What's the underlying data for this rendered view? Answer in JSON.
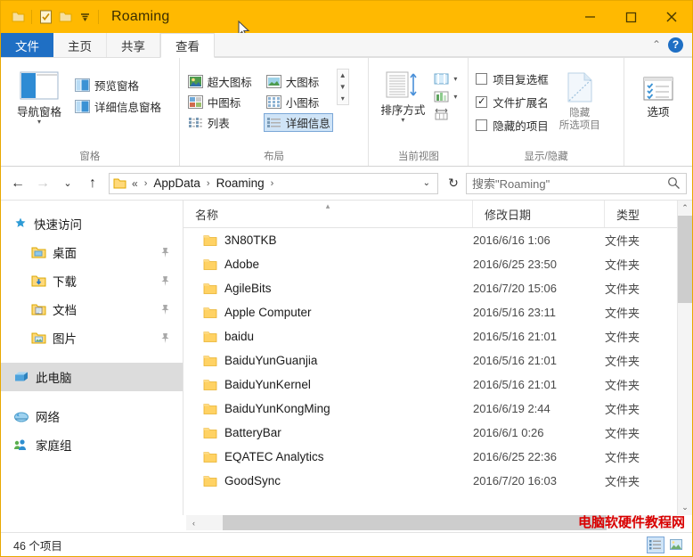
{
  "window": {
    "title": "Roaming",
    "quick_access": [
      {
        "name": "folder-icon",
        "label": ""
      },
      {
        "name": "properties-icon",
        "label": ""
      },
      {
        "name": "new-folder-icon",
        "label": ""
      },
      {
        "name": "chevron-down-icon",
        "label": "▾"
      }
    ],
    "controls": {
      "minimize": "—",
      "maximize": "□",
      "close": "✕"
    }
  },
  "tabs": [
    {
      "id": "file",
      "label": "文件"
    },
    {
      "id": "home",
      "label": "主页"
    },
    {
      "id": "share",
      "label": "共享"
    },
    {
      "id": "view",
      "label": "查看"
    }
  ],
  "tabstrip_right": {
    "collapse": "⌃",
    "help": "?"
  },
  "ribbon": {
    "groups": [
      {
        "id": "panes",
        "label": "窗格",
        "big": {
          "label": "导航窗格",
          "caret": "▾",
          "icon": "navigation-pane-icon"
        },
        "items": [
          {
            "label": "预览窗格",
            "icon": "preview-pane-icon"
          },
          {
            "label": "详细信息窗格",
            "icon": "details-pane-icon"
          }
        ]
      },
      {
        "id": "layout",
        "label": "布局",
        "items": [
          {
            "label": "超大图标",
            "icon": "extra-large-icons-icon",
            "selected": false
          },
          {
            "label": "大图标",
            "icon": "large-icons-icon",
            "selected": false
          },
          {
            "label": "中图标",
            "icon": "medium-icons-icon",
            "selected": false
          },
          {
            "label": "小图标",
            "icon": "small-icons-icon",
            "selected": false
          },
          {
            "label": "列表",
            "icon": "list-icon",
            "selected": false
          },
          {
            "label": "详细信息",
            "icon": "details-icon",
            "selected": true
          }
        ]
      },
      {
        "id": "current_view",
        "label": "当前视图",
        "big": {
          "label": "排序方式",
          "caret": "▾",
          "icon": "sort-by-icon"
        },
        "items": [
          {
            "label": "",
            "icon": "add-columns-icon"
          },
          {
            "label": "",
            "icon": "group-by-icon"
          },
          {
            "label": "",
            "icon": "size-all-columns-icon"
          }
        ]
      },
      {
        "id": "show_hide",
        "label": "显示/隐藏",
        "checkboxes": [
          {
            "label": "项目复选框",
            "checked": false
          },
          {
            "label": "文件扩展名",
            "checked": true
          },
          {
            "label": "隐藏的项目",
            "checked": false
          }
        ],
        "big": {
          "label_line1": "隐藏",
          "label_line2": "所选项目",
          "icon": "hide-selected-items-icon"
        }
      },
      {
        "id": "options",
        "label": "",
        "big": {
          "label": "选项",
          "icon": "options-icon"
        }
      }
    ]
  },
  "address_bar": {
    "back": "←",
    "forward": "→",
    "recent": "⌄",
    "up": "↑",
    "folder_icon": "folder-icon",
    "crumbs": [
      "«",
      "AppData",
      "Roaming"
    ],
    "separator": "›",
    "dropdown": "⌄",
    "refresh": "↻",
    "search_placeholder": "搜索\"Roaming\""
  },
  "sidebar": {
    "items": [
      {
        "label": "快速访问",
        "icon": "star-pin-icon",
        "indent": false,
        "pinned": false,
        "selected": false
      },
      {
        "label": "桌面",
        "icon": "desktop-folder-icon",
        "indent": true,
        "pinned": true,
        "selected": false
      },
      {
        "label": "下载",
        "icon": "downloads-folder-icon",
        "indent": true,
        "pinned": true,
        "selected": false
      },
      {
        "label": "文档",
        "icon": "documents-folder-icon",
        "indent": true,
        "pinned": true,
        "selected": false
      },
      {
        "label": "图片",
        "icon": "pictures-folder-icon",
        "indent": true,
        "pinned": true,
        "selected": false
      },
      {
        "label": "此电脑",
        "icon": "this-pc-icon",
        "indent": false,
        "pinned": false,
        "selected": true
      },
      {
        "label": "网络",
        "icon": "network-icon",
        "indent": false,
        "pinned": false,
        "selected": false
      },
      {
        "label": "家庭组",
        "icon": "homegroup-icon",
        "indent": false,
        "pinned": false,
        "selected": false
      }
    ],
    "pin_glyph": "📌"
  },
  "file_list": {
    "columns": [
      {
        "id": "name",
        "label": "名称",
        "sorted": "asc",
        "sort_glyph": "▴"
      },
      {
        "id": "date",
        "label": "修改日期",
        "sorted": null,
        "sort_glyph": ""
      },
      {
        "id": "type",
        "label": "类型",
        "sorted": null,
        "sort_glyph": ""
      }
    ],
    "rows": [
      {
        "name": "3N80TKB",
        "date": "2016/6/16 1:06",
        "type": "文件夹",
        "icon": "folder-icon"
      },
      {
        "name": "Adobe",
        "date": "2016/6/25 23:50",
        "type": "文件夹",
        "icon": "folder-icon"
      },
      {
        "name": "AgileBits",
        "date": "2016/7/20 15:06",
        "type": "文件夹",
        "icon": "folder-icon"
      },
      {
        "name": "Apple Computer",
        "date": "2016/5/16 23:11",
        "type": "文件夹",
        "icon": "folder-icon"
      },
      {
        "name": "baidu",
        "date": "2016/5/16 21:01",
        "type": "文件夹",
        "icon": "folder-icon"
      },
      {
        "name": "BaiduYunGuanjia",
        "date": "2016/5/16 21:01",
        "type": "文件夹",
        "icon": "folder-icon"
      },
      {
        "name": "BaiduYunKernel",
        "date": "2016/5/16 21:01",
        "type": "文件夹",
        "icon": "folder-icon"
      },
      {
        "name": "BaiduYunKongMing",
        "date": "2016/6/19 2:44",
        "type": "文件夹",
        "icon": "folder-icon"
      },
      {
        "name": "BatteryBar",
        "date": "2016/6/1 0:26",
        "type": "文件夹",
        "icon": "folder-icon"
      },
      {
        "name": "EQATEC Analytics",
        "date": "2016/6/25 22:36",
        "type": "文件夹",
        "icon": "folder-icon"
      },
      {
        "name": "GoodSync",
        "date": "2016/7/20 16:03",
        "type": "文件夹",
        "icon": "folder-icon"
      }
    ]
  },
  "scrollbars": {
    "vertical": {
      "up": "⌃",
      "down": "⌄"
    },
    "horizontal": {
      "left": "‹",
      "right": "›"
    }
  },
  "status_bar": {
    "item_count": "46 个项目",
    "view_buttons": [
      {
        "name": "details-view-button",
        "active": true
      },
      {
        "name": "large-icons-view-button",
        "active": false
      }
    ]
  },
  "watermark": "电脑软硬件教程网",
  "colors": {
    "titlebar": "#FFB901",
    "file_tab": "#1F6FC4",
    "selection": "#cfe4f7",
    "folder_yellow": "#FFCF5A",
    "watermark_red": "#d90000"
  }
}
